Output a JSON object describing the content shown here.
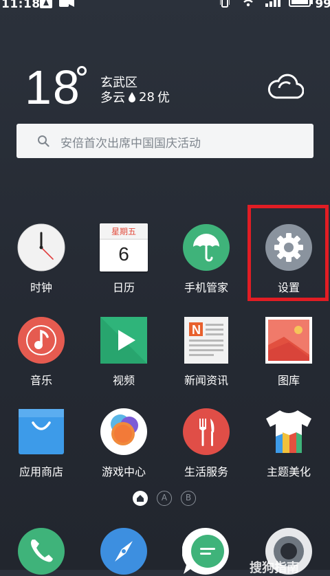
{
  "status_bar": {
    "time": "11:18",
    "battery": "99"
  },
  "weather": {
    "temperature": "18",
    "district": "玄武区",
    "condition": "多云",
    "aqi_value": "28",
    "aqi_level": "优"
  },
  "search": {
    "placeholder": "安倍首次出席中国国庆活动"
  },
  "apps": [
    {
      "label": "时钟",
      "icon": "clock-icon"
    },
    {
      "label": "日历",
      "icon": "calendar-icon",
      "weekday": "星期五",
      "day": "6"
    },
    {
      "label": "手机管家",
      "icon": "phone-manager-icon"
    },
    {
      "label": "设置",
      "icon": "settings-icon"
    },
    {
      "label": "音乐",
      "icon": "music-icon"
    },
    {
      "label": "视频",
      "icon": "video-icon"
    },
    {
      "label": "新闻资讯",
      "icon": "news-icon"
    },
    {
      "label": "图库",
      "icon": "gallery-icon"
    },
    {
      "label": "应用商店",
      "icon": "app-store-icon"
    },
    {
      "label": "游戏中心",
      "icon": "game-center-icon"
    },
    {
      "label": "生活服务",
      "icon": "life-service-icon"
    },
    {
      "label": "主题美化",
      "icon": "theme-icon"
    }
  ],
  "page_indicator": {
    "pages": [
      "home",
      "A",
      "B"
    ],
    "active": "home"
  },
  "dock": [
    {
      "icon": "phone-icon"
    },
    {
      "icon": "browser-icon"
    },
    {
      "icon": "messages-icon"
    },
    {
      "icon": "camera-icon"
    }
  ],
  "watermark": "搜狗指南",
  "colors": {
    "highlight": "#e11d24",
    "background": "#282d36"
  }
}
